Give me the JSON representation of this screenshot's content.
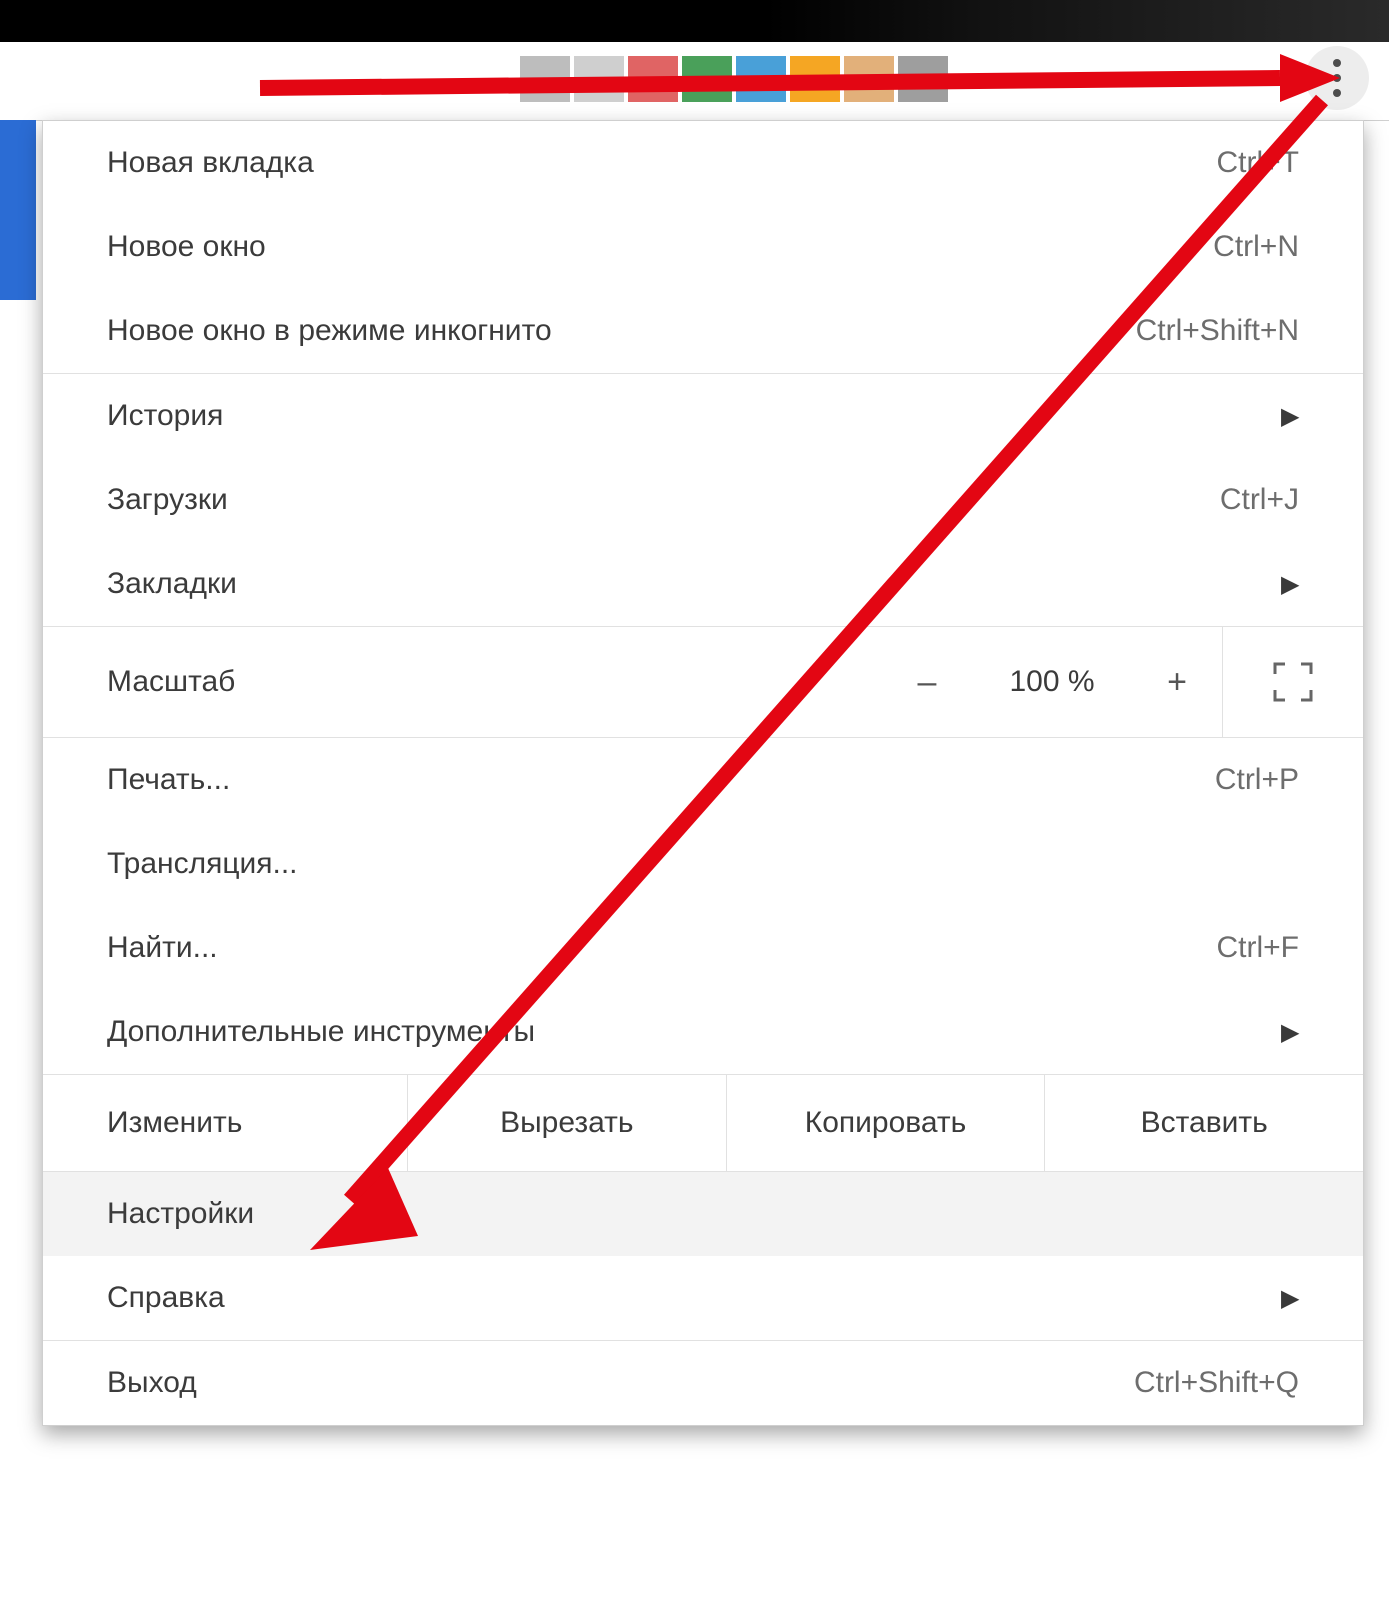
{
  "toolbar": {
    "extension_colors": [
      "#bdbdbd",
      "#cfcfcf",
      "#e06464",
      "#4aa05a",
      "#49a0d8",
      "#f5a623",
      "#e2b07a",
      "#9e9e9e"
    ]
  },
  "menu_button": {
    "name": "more-icon"
  },
  "menu": {
    "group1": [
      {
        "label": "Новая вкладка",
        "shortcut": "Ctrl+T",
        "submenu": false
      },
      {
        "label": "Новое окно",
        "shortcut": "Ctrl+N",
        "submenu": false
      },
      {
        "label": "Новое окно в режиме инкогнито",
        "shortcut": "Ctrl+Shift+N",
        "submenu": false
      }
    ],
    "group2": [
      {
        "label": "История",
        "shortcut": "",
        "submenu": true
      },
      {
        "label": "Загрузки",
        "shortcut": "Ctrl+J",
        "submenu": false
      },
      {
        "label": "Закладки",
        "shortcut": "",
        "submenu": true
      }
    ],
    "zoom": {
      "label": "Масштаб",
      "minus": "–",
      "value": "100 %",
      "plus": "+",
      "fullscreen_name": "fullscreen-icon"
    },
    "group3": [
      {
        "label": "Печать...",
        "shortcut": "Ctrl+P",
        "submenu": false
      },
      {
        "label": "Трансляция...",
        "shortcut": "",
        "submenu": false
      },
      {
        "label": "Найти...",
        "shortcut": "Ctrl+F",
        "submenu": false
      },
      {
        "label": "Дополнительные инструменты",
        "shortcut": "",
        "submenu": true
      }
    ],
    "edit": {
      "label": "Изменить",
      "cut": "Вырезать",
      "copy": "Копировать",
      "paste": "Вставить"
    },
    "group4": [
      {
        "label": "Настройки",
        "shortcut": "",
        "submenu": false,
        "hover": true
      },
      {
        "label": "Справка",
        "shortcut": "",
        "submenu": true
      }
    ],
    "group5": [
      {
        "label": "Выход",
        "shortcut": "Ctrl+Shift+Q",
        "submenu": false
      }
    ]
  },
  "annotation": {
    "color": "#e30613"
  }
}
